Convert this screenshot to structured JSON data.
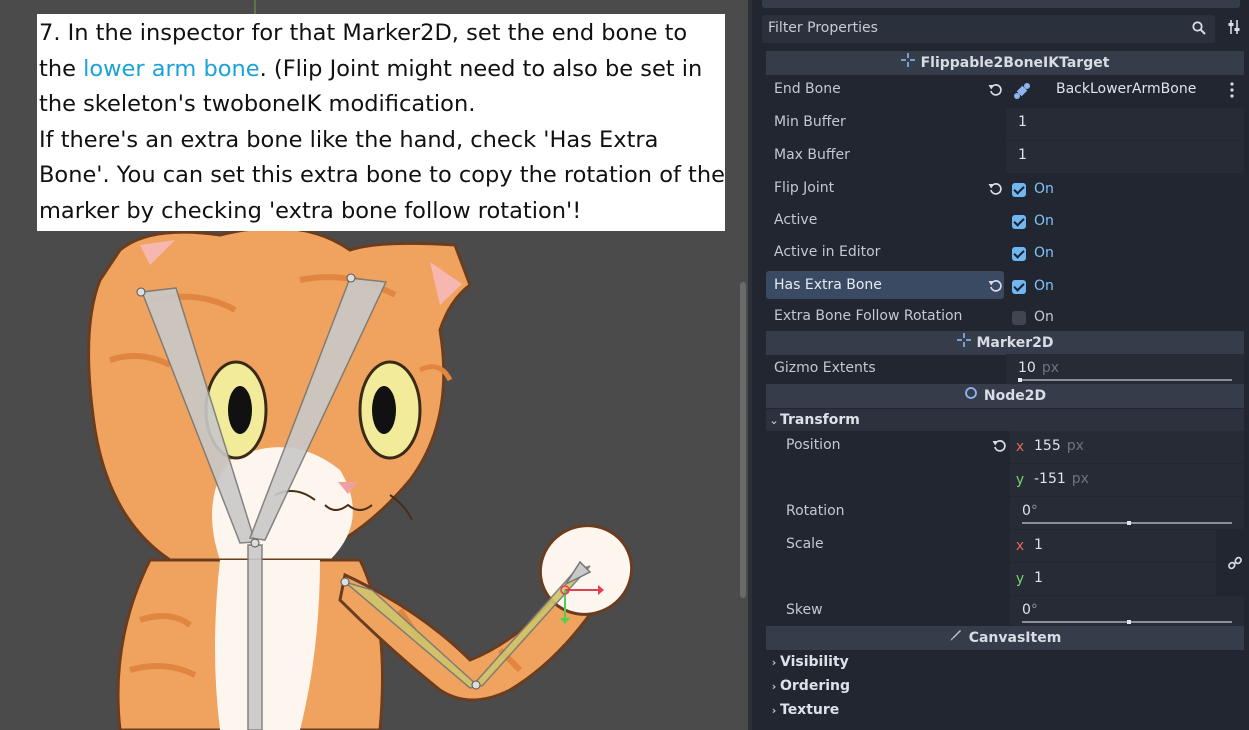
{
  "tutorial": {
    "step_prefix": "7. In the inspector for that Marker2D, set the end bone to the ",
    "highlight": "lower arm bone",
    "line_rest": ". (Flip Joint might need to also be set in the skeleton's twoboneIK modification.",
    "line2": "If there's an extra bone like the hand, check 'Has Extra Bone'. You can set this extra bone to copy the rotation of the marker by checking 'extra bone follow rotation'!"
  },
  "inspector": {
    "filter_placeholder": "Filter Properties",
    "sections": {
      "ik_target": "Flippable2BoneIKTarget",
      "marker": "Marker2D",
      "node2d": "Node2D",
      "canvas_item": "CanvasItem"
    },
    "props": {
      "end_bone": {
        "label": "End Bone",
        "value": "BackLowerArmBone"
      },
      "min_buffer": {
        "label": "Min Buffer",
        "value": "1"
      },
      "max_buffer": {
        "label": "Max Buffer",
        "value": "1"
      },
      "flip_joint": {
        "label": "Flip Joint",
        "state": "On"
      },
      "active": {
        "label": "Active",
        "state": "On"
      },
      "active_in_editor": {
        "label": "Active in Editor",
        "state": "On"
      },
      "has_extra_bone": {
        "label": "Has Extra Bone",
        "state": "On"
      },
      "extra_bone_follow_rotation": {
        "label": "Extra Bone Follow Rotation",
        "state": "On"
      },
      "gizmo_extents": {
        "label": "Gizmo Extents",
        "value": "10",
        "unit": "px",
        "level": 0.01
      }
    },
    "transform": {
      "group_label": "Transform",
      "position_label": "Position",
      "pos_x": "155",
      "pos_y": "-151",
      "pos_unit": "px",
      "rotation_label": "Rotation",
      "rotation_value": "0",
      "scale_label": "Scale",
      "scale_x": "1",
      "scale_y": "1",
      "skew_label": "Skew",
      "skew_value": "0",
      "degree": "°",
      "axis_x": "x",
      "axis_y": "y"
    },
    "canvas_groups": [
      "Visibility",
      "Ordering",
      "Texture"
    ]
  },
  "colors": {
    "checkbox_on": "#6fb7f2",
    "highlight_row": "#3a4a63",
    "link_text": "#1aa3d8"
  }
}
